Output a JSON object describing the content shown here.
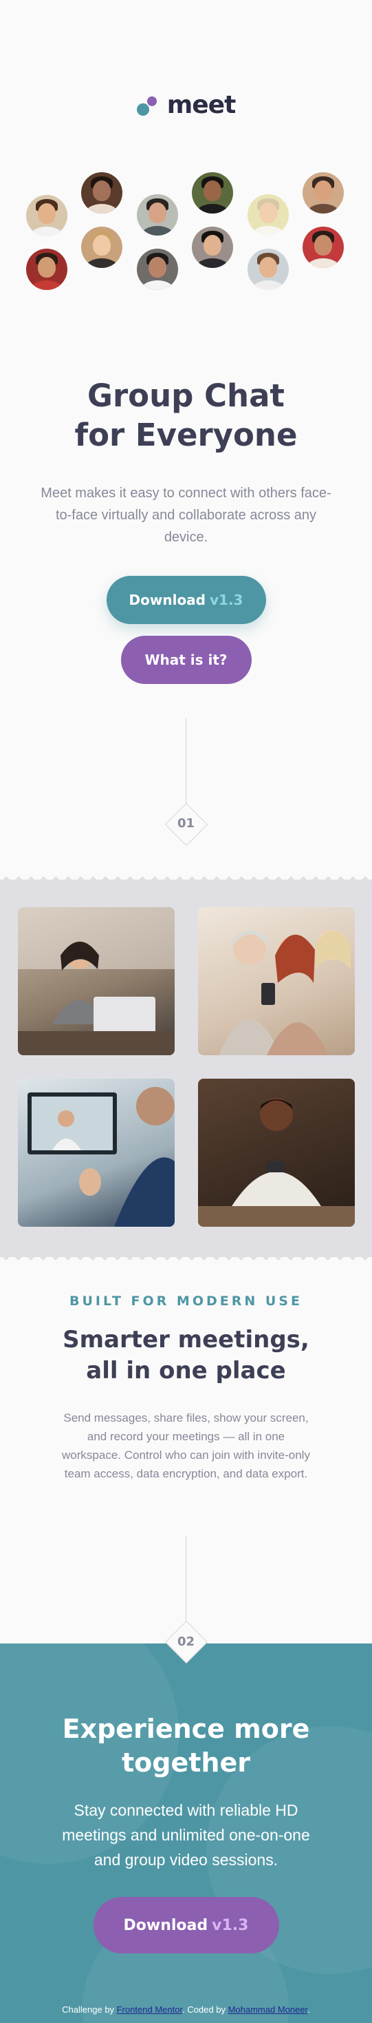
{
  "brand": {
    "name": "meet"
  },
  "colors": {
    "primary": "#4e96a4",
    "secondary": "#8c5fb0",
    "dark": "#3d3f55",
    "muted": "#87889a"
  },
  "hero": {
    "title_line1": "Group Chat",
    "title_line2": "for Everyone",
    "description": "Meet makes it easy to connect with others face-to-face virtually and collaborate across any device.",
    "download_label": "Download",
    "download_version": "v1.3",
    "secondary_label": "What is it?"
  },
  "avatars": [
    "avatar-woman",
    "avatar-woman",
    "avatar-man",
    "avatar-man",
    "avatar-man",
    "avatar-woman",
    "avatar-man",
    "avatar-woman",
    "avatar-man",
    "avatar-man",
    "avatar-man",
    "avatar-woman"
  ],
  "step1": {
    "number": "01"
  },
  "gallery": {
    "photos": [
      "photo-woman-laptop",
      "photo-women-phone",
      "photo-video-call",
      "photo-man-phone"
    ]
  },
  "features": {
    "eyebrow": "BUILT FOR MODERN USE",
    "title_line1": "Smarter meetings,",
    "title_line2": "all in one place",
    "description": "Send messages, share files, show your screen, and record your meetings — all in one workspace. Control who can join with invite-only team access, data encryption, and data export."
  },
  "step2": {
    "number": "02"
  },
  "cta": {
    "title_line1": "Experience more",
    "title_line2": "together",
    "description": "Stay connected with reliable HD meetings and unlimited one-on-one and group video sessions.",
    "download_label": "Download",
    "download_version": "v1.3"
  },
  "attribution": {
    "prefix": "Challenge by",
    "mentor_link": "Frontend Mentor",
    "middle": ". Coded by",
    "author_link": "Mohammad Moneer",
    "suffix": "."
  }
}
